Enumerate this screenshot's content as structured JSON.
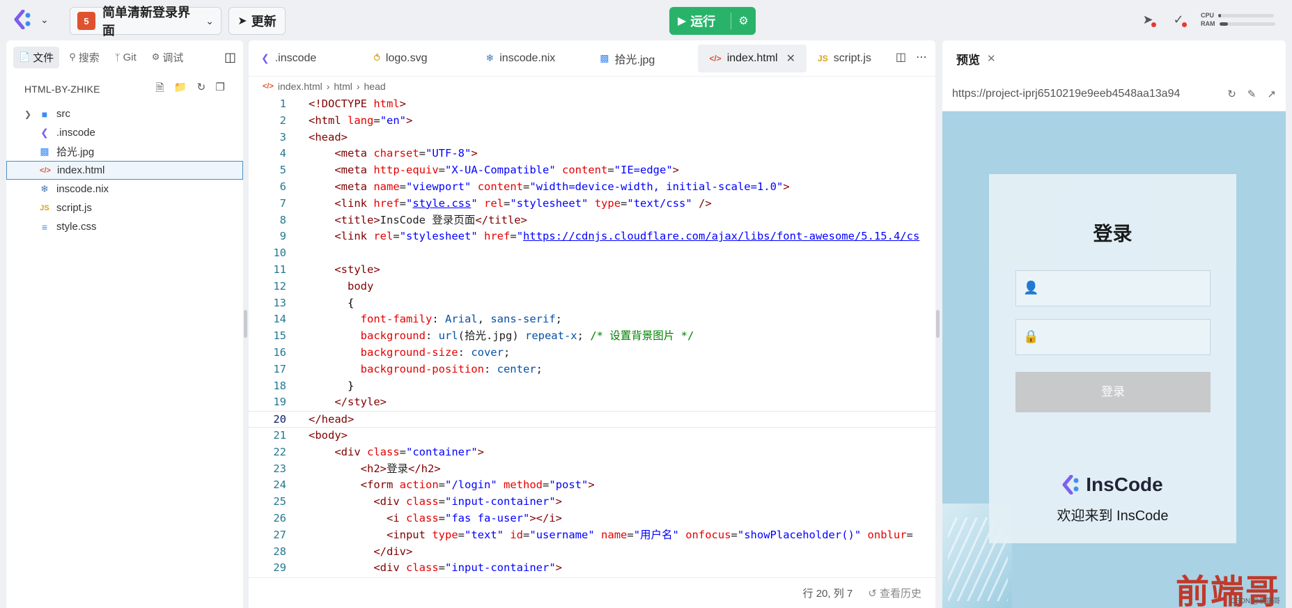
{
  "topbar": {
    "project_name": "简单清新登录界面",
    "project_badge": "5",
    "update_label": "更新",
    "run_label": "运行",
    "cpu_label": "CPU",
    "ram_label": "RAM",
    "cpu_level": 0.05,
    "ram_level": 0.15
  },
  "left_panel": {
    "tabs": [
      {
        "label": "文件",
        "icon": "file-icon"
      },
      {
        "label": "搜索",
        "icon": "search-icon"
      },
      {
        "label": "Git",
        "icon": "git-icon"
      },
      {
        "label": "调试",
        "icon": "bug-icon"
      }
    ],
    "project_title": "HTML-BY-ZHIKE",
    "tree": [
      {
        "name": "src",
        "type": "folder"
      },
      {
        "name": ".inscode",
        "type": "inscode"
      },
      {
        "name": "拾光.jpg",
        "type": "image"
      },
      {
        "name": "index.html",
        "type": "html",
        "selected": true
      },
      {
        "name": "inscode.nix",
        "type": "nix"
      },
      {
        "name": "script.js",
        "type": "js"
      },
      {
        "name": "style.css",
        "type": "css"
      }
    ]
  },
  "editor": {
    "tabs": [
      {
        "label": ".inscode",
        "icon": "inscode-icon"
      },
      {
        "label": "logo.svg",
        "icon": "svg-icon"
      },
      {
        "label": "inscode.nix",
        "icon": "nix-icon"
      },
      {
        "label": "拾光.jpg",
        "icon": "image-icon"
      },
      {
        "label": "index.html",
        "icon": "html-icon",
        "active": true
      },
      {
        "label": "script.js",
        "icon": "js-icon"
      }
    ],
    "breadcrumb": [
      "index.html",
      "html",
      "head"
    ],
    "current_line": 20,
    "status_position": "行 20, 列 7",
    "status_history": "查看历史"
  },
  "preview": {
    "title": "预览",
    "url": "https://project-iprj6510219e9eeb4548aa13a94",
    "login_title": "登录",
    "login_button": "登录",
    "brand_name": "InsCode",
    "welcome": "欢迎来到 InsCode",
    "watermark": "前端哥",
    "csdn": "CSDN @前端哥"
  },
  "colors": {
    "run_green": "#29b36a",
    "accent_blue": "#4a90c2",
    "inscode_purple": "#7b5cf0",
    "inscode_blue": "#3b8cf7"
  }
}
